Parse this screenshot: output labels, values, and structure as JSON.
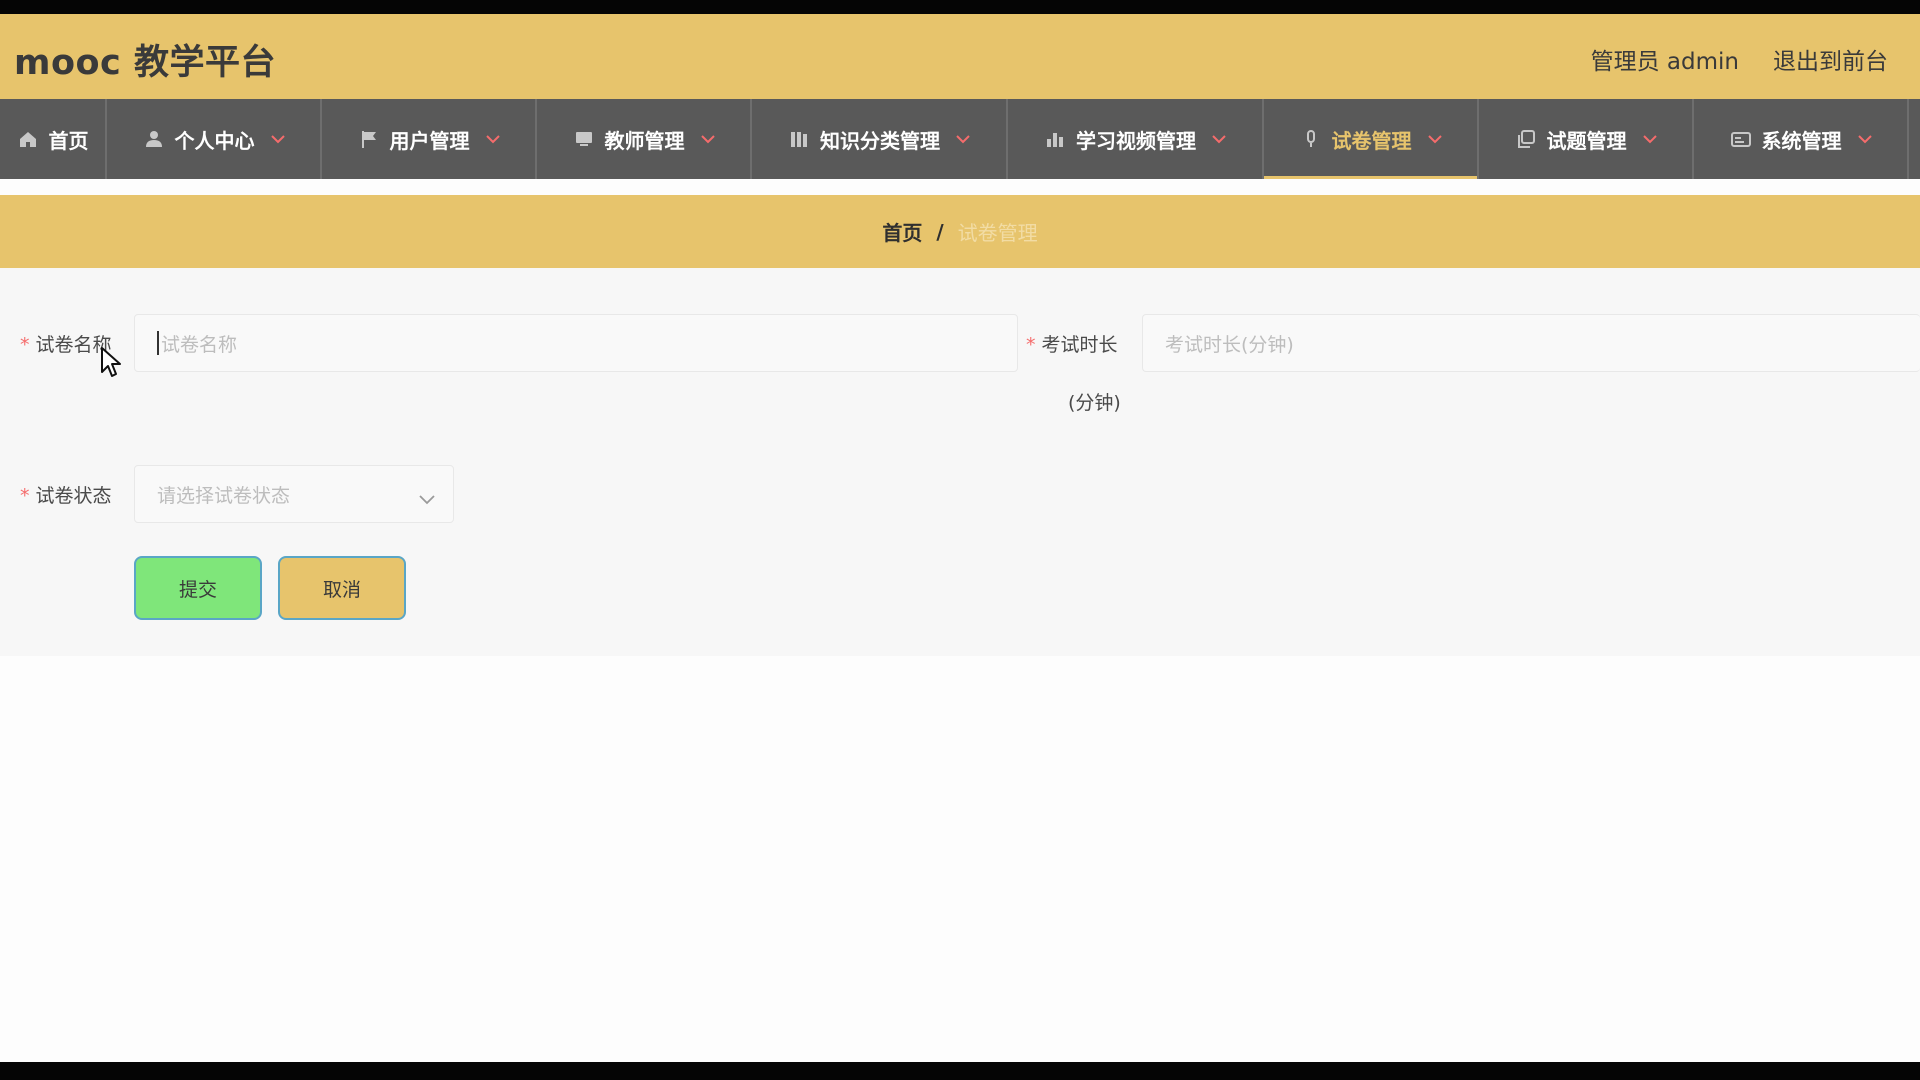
{
  "header": {
    "brand": "mooc 教学平台",
    "user_label": "管理员 admin",
    "exit_label": "退出到前台"
  },
  "nav": {
    "items": [
      {
        "label": "首页",
        "icon": "home-icon"
      },
      {
        "label": "个人中心",
        "icon": "user-icon"
      },
      {
        "label": "用户管理",
        "icon": "flag-icon"
      },
      {
        "label": "教师管理",
        "icon": "monitor-icon"
      },
      {
        "label": "知识分类管理",
        "icon": "books-icon"
      },
      {
        "label": "学习视频管理",
        "icon": "bar-chart-icon"
      },
      {
        "label": "试卷管理",
        "icon": "mic-icon"
      },
      {
        "label": "试题管理",
        "icon": "copy-icon"
      },
      {
        "label": "系统管理",
        "icon": "id-card-icon"
      }
    ],
    "active_index": 6,
    "colors": {
      "active": "#e7c46c",
      "background": "#595959"
    }
  },
  "breadcrumb": {
    "home": "首页",
    "separator": "/",
    "current": "试卷管理"
  },
  "form": {
    "paper_name_label": "试卷名称",
    "paper_name_placeholder": "试卷名称",
    "duration_label_line1": "考试时长",
    "duration_label_line2": "(分钟)",
    "duration_placeholder": "考试时长(分钟)",
    "status_label": "试卷状态",
    "status_placeholder": "请选择试卷状态",
    "required_mark": "*"
  },
  "buttons": {
    "submit": "提交",
    "cancel": "取消"
  },
  "colors": {
    "header": "#e7c46c",
    "submit": "#7fe67a",
    "cancel": "#e7c46c",
    "required": "#f56c6c"
  }
}
